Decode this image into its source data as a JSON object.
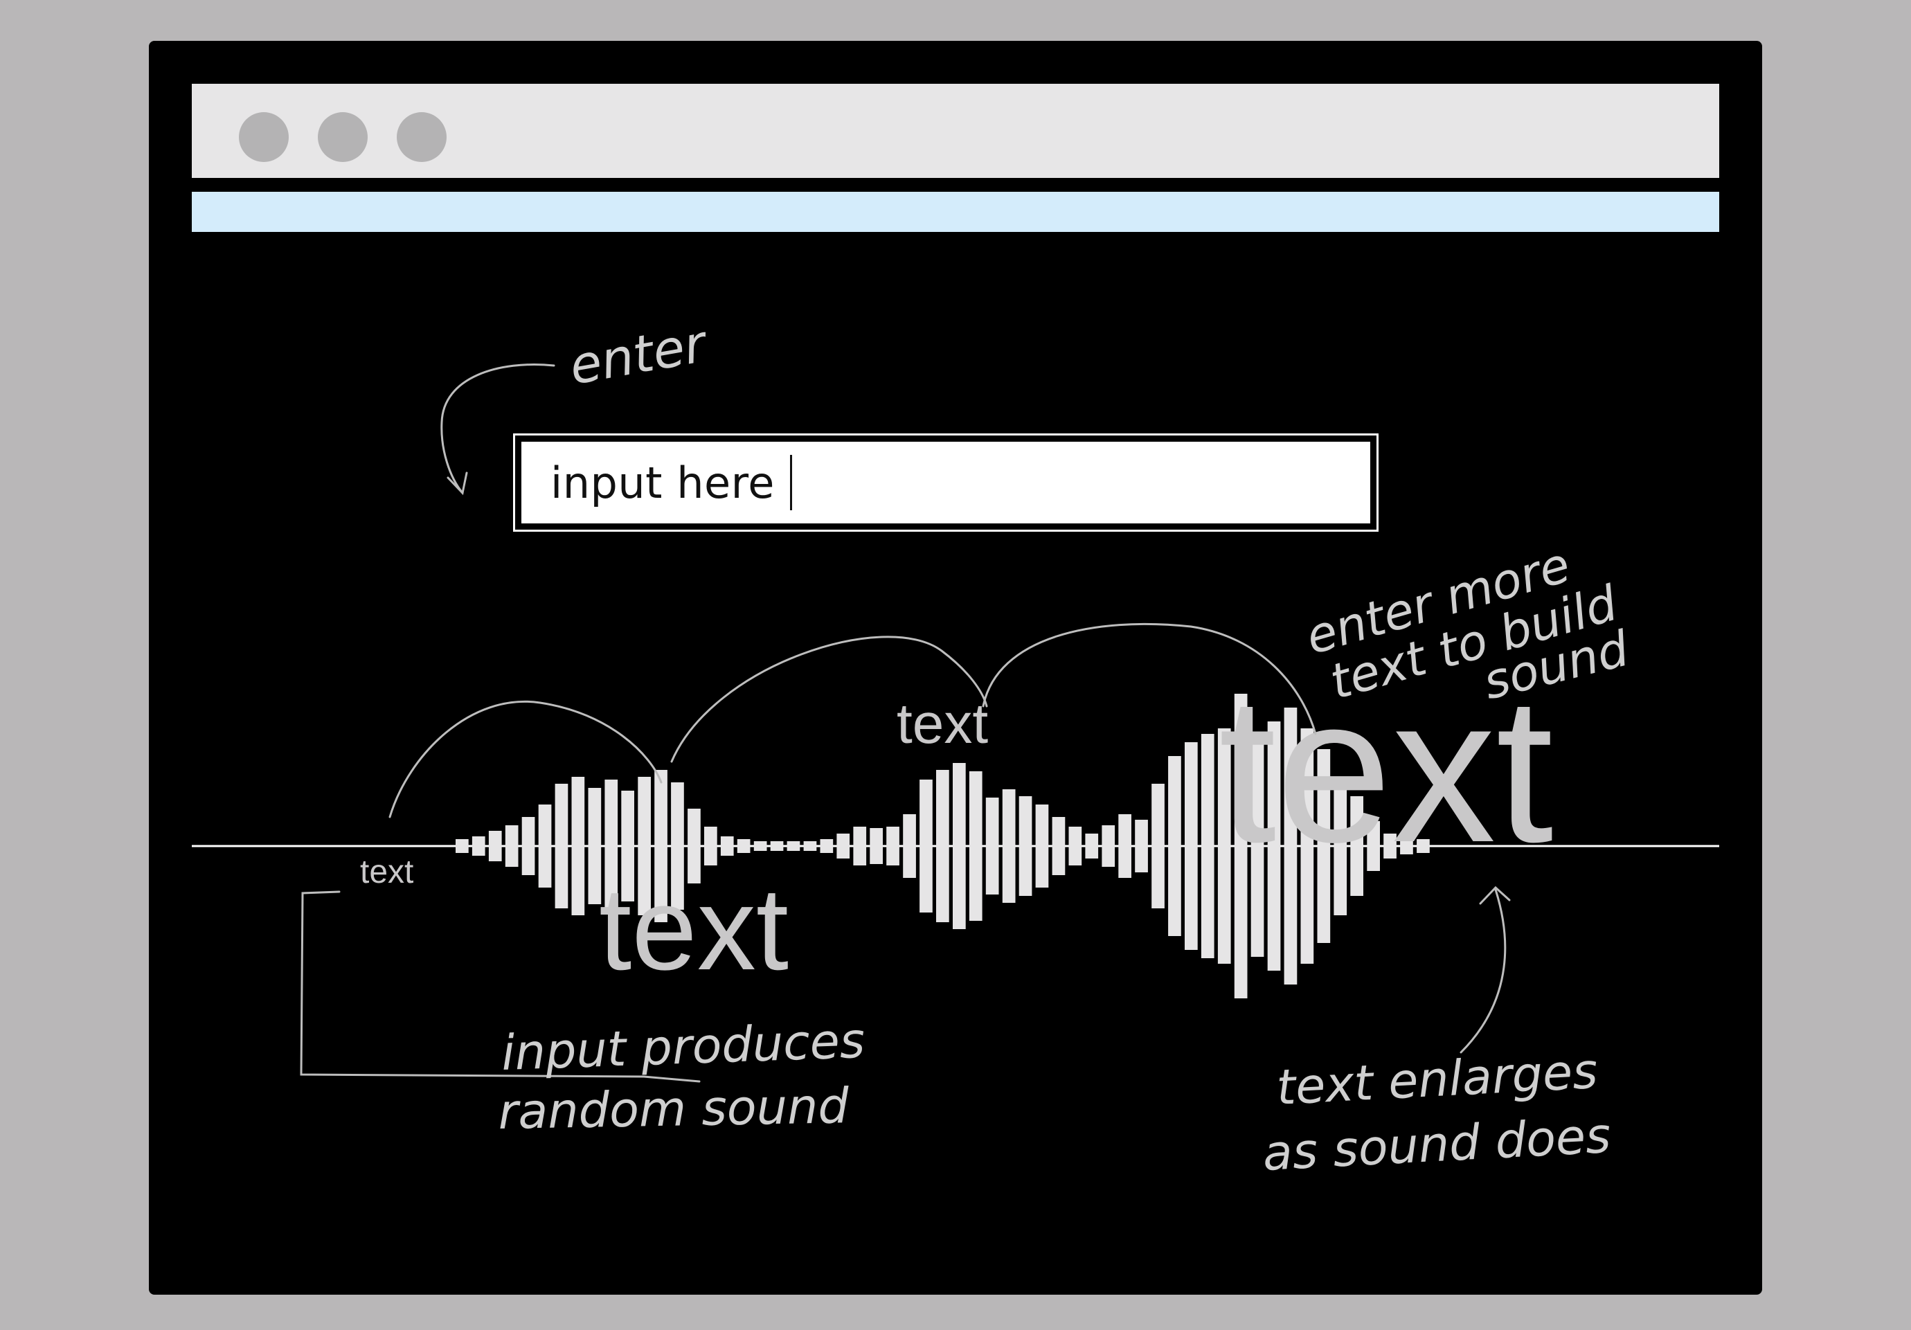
{
  "browser": {
    "window_controls": [
      "window-dot",
      "window-dot",
      "window-dot"
    ]
  },
  "input": {
    "value": "input here"
  },
  "wave_labels": {
    "small": "text",
    "medium_low": "text",
    "medium_high": "text",
    "large": "text"
  },
  "annotations": {
    "enter": "enter",
    "enter_more_1": "enter more",
    "enter_more_2": "text to build",
    "enter_more_3": "sound",
    "input_produces_1": "input produces",
    "input_produces_2": "random sound",
    "text_enlarges_1": "text enlarges",
    "text_enlarges_2": "as sound does"
  },
  "colors": {
    "frame": "#000000",
    "titlebar": "#e7e6e7",
    "addressbar": "#d4ecfb",
    "waveform": "#e6e5e6",
    "annotation": "#cfcfcf"
  },
  "waveform": {
    "amplitudes": [
      10,
      14,
      22,
      30,
      42,
      60,
      90,
      100,
      84,
      96,
      80,
      100,
      110,
      92,
      54,
      28,
      14,
      10,
      7,
      7,
      7,
      7,
      10,
      18,
      28,
      26,
      28,
      46,
      96,
      110,
      120,
      108,
      70,
      82,
      72,
      60,
      42,
      28,
      18,
      30,
      46,
      38,
      90,
      130,
      150,
      162,
      170,
      220,
      160,
      180,
      200,
      170,
      140,
      100,
      72,
      36,
      18,
      12,
      10
    ]
  }
}
